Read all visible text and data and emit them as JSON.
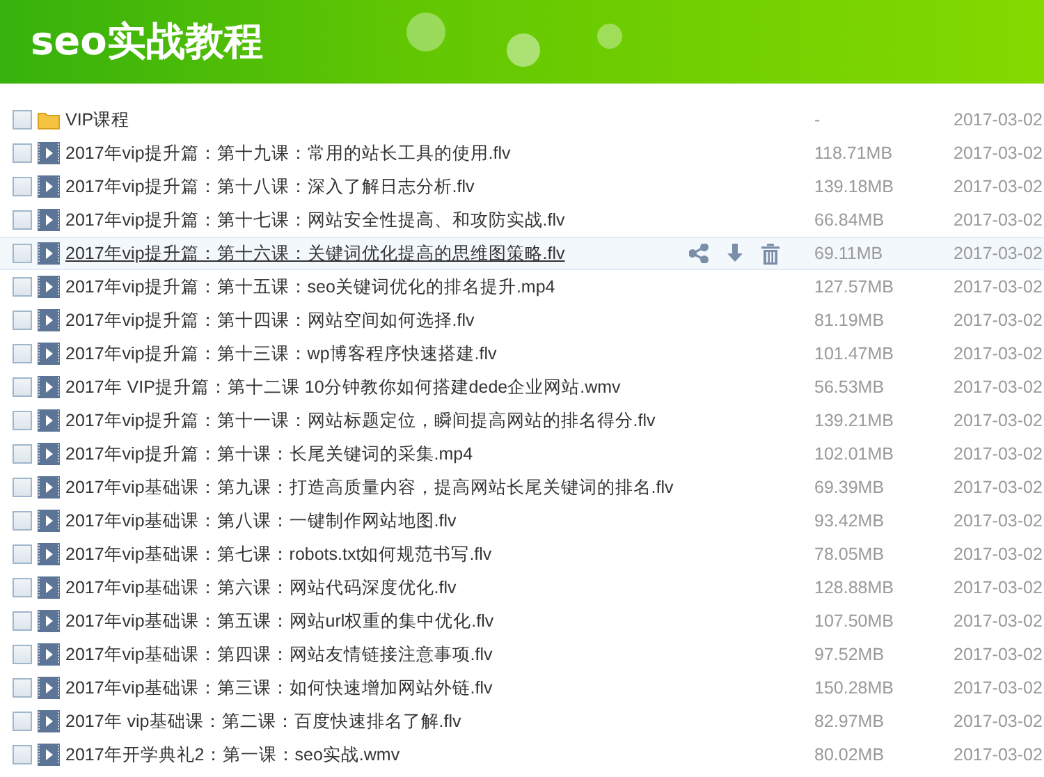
{
  "header": {
    "title": "seo实战教程"
  },
  "files": [
    {
      "kind": "folder",
      "name": "VIP课程",
      "size": "-",
      "date": "2017-03-02",
      "checked": false,
      "hovered": false
    },
    {
      "kind": "video",
      "name": "2017年vip提升篇：第十九课：常用的站长工具的使用.flv",
      "size": "118.71MB",
      "date": "2017-03-02",
      "checked": false,
      "hovered": false
    },
    {
      "kind": "video",
      "name": "2017年vip提升篇：第十八课：深入了解日志分析.flv",
      "size": "139.18MB",
      "date": "2017-03-02",
      "checked": false,
      "hovered": false
    },
    {
      "kind": "video",
      "name": "2017年vip提升篇：第十七课：网站安全性提高、和攻防实战.flv",
      "size": "66.84MB",
      "date": "2017-03-02",
      "checked": false,
      "hovered": false
    },
    {
      "kind": "video",
      "name": "2017年vip提升篇：第十六课：关键词优化提高的思维图策略.flv",
      "size": "69.11MB",
      "date": "2017-03-02",
      "checked": false,
      "hovered": true
    },
    {
      "kind": "video",
      "name": "2017年vip提升篇：第十五课：seo关键词优化的排名提升.mp4",
      "size": "127.57MB",
      "date": "2017-03-02",
      "checked": false,
      "hovered": false
    },
    {
      "kind": "video",
      "name": "2017年vip提升篇：第十四课：网站空间如何选择.flv",
      "size": "81.19MB",
      "date": "2017-03-02",
      "checked": false,
      "hovered": false
    },
    {
      "kind": "video",
      "name": "2017年vip提升篇：第十三课：wp博客程序快速搭建.flv",
      "size": "101.47MB",
      "date": "2017-03-02",
      "checked": false,
      "hovered": false
    },
    {
      "kind": "video",
      "name": "2017年 VIP提升篇：第十二课 10分钟教你如何搭建dede企业网站.wmv",
      "size": "56.53MB",
      "date": "2017-03-02",
      "checked": false,
      "hovered": false
    },
    {
      "kind": "video",
      "name": "2017年vip提升篇：第十一课：网站标题定位，瞬间提高网站的排名得分.flv",
      "size": "139.21MB",
      "date": "2017-03-02",
      "checked": false,
      "hovered": false
    },
    {
      "kind": "video",
      "name": "2017年vip提升篇：第十课：长尾关键词的采集.mp4",
      "size": "102.01MB",
      "date": "2017-03-02",
      "checked": false,
      "hovered": false
    },
    {
      "kind": "video",
      "name": "2017年vip基础课：第九课：打造高质量内容，提高网站长尾关键词的排名.flv",
      "size": "69.39MB",
      "date": "2017-03-02",
      "checked": false,
      "hovered": false
    },
    {
      "kind": "video",
      "name": "2017年vip基础课：第八课：一键制作网站地图.flv",
      "size": "93.42MB",
      "date": "2017-03-02",
      "checked": false,
      "hovered": false
    },
    {
      "kind": "video",
      "name": "2017年vip基础课：第七课：robots.txt如何规范书写.flv",
      "size": "78.05MB",
      "date": "2017-03-02",
      "checked": false,
      "hovered": false
    },
    {
      "kind": "video",
      "name": "2017年vip基础课：第六课：网站代码深度优化.flv",
      "size": "128.88MB",
      "date": "2017-03-02",
      "checked": false,
      "hovered": false
    },
    {
      "kind": "video",
      "name": "2017年vip基础课：第五课：网站url权重的集中优化.flv",
      "size": "107.50MB",
      "date": "2017-03-02",
      "checked": false,
      "hovered": false
    },
    {
      "kind": "video",
      "name": "2017年vip基础课：第四课：网站友情链接注意事项.flv",
      "size": "97.52MB",
      "date": "2017-03-02",
      "checked": false,
      "hovered": false
    },
    {
      "kind": "video",
      "name": "2017年vip基础课：第三课：如何快速增加网站外链.flv",
      "size": "150.28MB",
      "date": "2017-03-02",
      "checked": false,
      "hovered": false
    },
    {
      "kind": "video",
      "name": "2017年 vip基础课：第二课：百度快速排名了解.flv",
      "size": "82.97MB",
      "date": "2017-03-02",
      "checked": false,
      "hovered": false
    },
    {
      "kind": "video",
      "name": "2017年开学典礼2：第一课：seo实战.wmv",
      "size": "80.02MB",
      "date": "2017-03-02",
      "checked": false,
      "hovered": false
    }
  ]
}
